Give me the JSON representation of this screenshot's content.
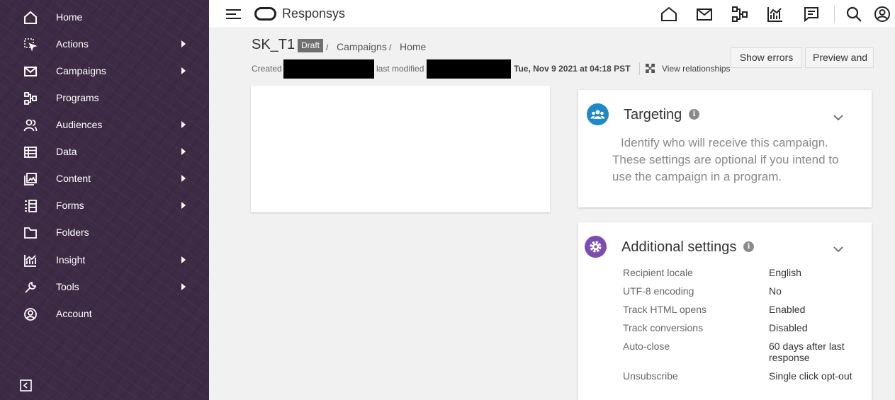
{
  "sidebar": {
    "items": [
      {
        "label": "Home",
        "icon": "home-icon",
        "has_submenu": false
      },
      {
        "label": "Actions",
        "icon": "actions-icon",
        "has_submenu": true
      },
      {
        "label": "Campaigns",
        "icon": "mail-icon",
        "has_submenu": true
      },
      {
        "label": "Programs",
        "icon": "program-flow-icon",
        "has_submenu": false
      },
      {
        "label": "Audiences",
        "icon": "users-icon",
        "has_submenu": true
      },
      {
        "label": "Data",
        "icon": "table-icon",
        "has_submenu": true
      },
      {
        "label": "Content",
        "icon": "content-image-icon",
        "has_submenu": true
      },
      {
        "label": "Forms",
        "icon": "form-list-icon",
        "has_submenu": true
      },
      {
        "label": "Folders",
        "icon": "folder-icon",
        "has_submenu": false
      },
      {
        "label": "Insight",
        "icon": "chart-icon",
        "has_submenu": true
      },
      {
        "label": "Tools",
        "icon": "wrench-icon",
        "has_submenu": true
      },
      {
        "label": "Account",
        "icon": "account-circle-icon",
        "has_submenu": false
      }
    ],
    "collapse_icon": "collapse-sidebar-icon"
  },
  "topbar": {
    "brand": "Responsys",
    "icons": [
      "home-icon",
      "mail-icon",
      "program-flow-icon",
      "chart-icon",
      "notes-icon",
      "search-icon",
      "user-profile-icon"
    ]
  },
  "header": {
    "title": "SK_T1",
    "status": "Draft",
    "breadcrumb": [
      {
        "label": "Campaigns",
        "sep": "/"
      },
      {
        "label": "Home"
      }
    ],
    "title_sep": "/",
    "created_label": "Created",
    "modified_label": "last modified",
    "modified_date": "Tue, Nov 9 2021 at 04:18 PST",
    "view_relationships": "View relationships",
    "show_errors": "Show errors",
    "preview_and": "Preview and"
  },
  "targeting": {
    "title": "Targeting",
    "info": "i",
    "description": "Identify who will receive this campaign. These settings are optional if you intend to use the campaign in a program.",
    "accent": "#1e88c8"
  },
  "additional": {
    "title": "Additional settings",
    "info": "i",
    "accent": "#7d4cb3",
    "rows": [
      {
        "label": "Recipient locale",
        "value": "English"
      },
      {
        "label": "UTF-8 encoding",
        "value": "No"
      },
      {
        "label": "Track HTML opens",
        "value": "Enabled"
      },
      {
        "label": "Track conversions",
        "value": "Disabled"
      },
      {
        "label": "Auto-close",
        "value": "60 days after last response"
      },
      {
        "label": "Unsubscribe",
        "value": "Single click opt-out"
      }
    ]
  },
  "colors": {
    "sidebar_bg": "#3d2a44",
    "draft_badge": "#6f6f6f",
    "targeting_icon": "#1e88c8",
    "settings_icon": "#7d4cb3"
  }
}
